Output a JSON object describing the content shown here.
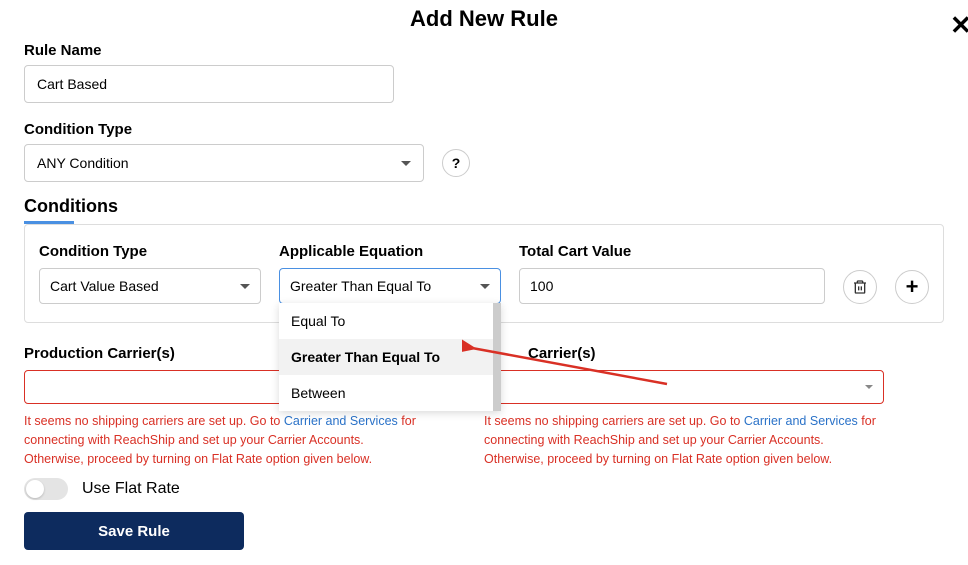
{
  "modal": {
    "title": "Add New Rule",
    "close_icon": "✕"
  },
  "rule_name": {
    "label": "Rule Name",
    "value": "Cart Based"
  },
  "condition_type_main": {
    "label": "Condition Type",
    "selected": "ANY Condition",
    "help_icon": "?"
  },
  "conditions": {
    "heading": "Conditions",
    "condition_type": {
      "label": "Condition Type",
      "selected": "Cart Value Based"
    },
    "equation": {
      "label": "Applicable Equation",
      "selected": "Greater Than Equal To",
      "options": [
        "Equal To",
        "Greater Than Equal To",
        "Between"
      ]
    },
    "value": {
      "label": "Total Cart Value",
      "value": "100"
    }
  },
  "production_carriers": {
    "label": "Production Carrier(s)",
    "warning_prefix": "It seems no shipping carriers are set up. Go to ",
    "warning_link": "Carrier and Services",
    "warning_suffix": " for connecting with ReachShip and set up your Carrier Accounts. Otherwise, proceed by turning on Flat Rate option given below."
  },
  "sandbox_carriers": {
    "label": "Carrier(s)",
    "warning_prefix": "It seems no shipping carriers are set up. Go to ",
    "warning_link": "Carrier and Services",
    "warning_suffix": " for connecting with ReachShip and set up your Carrier Accounts. Otherwise, proceed by turning on Flat Rate option given below."
  },
  "flat_rate": {
    "label": "Use Flat Rate"
  },
  "save": {
    "label": "Save Rule"
  }
}
